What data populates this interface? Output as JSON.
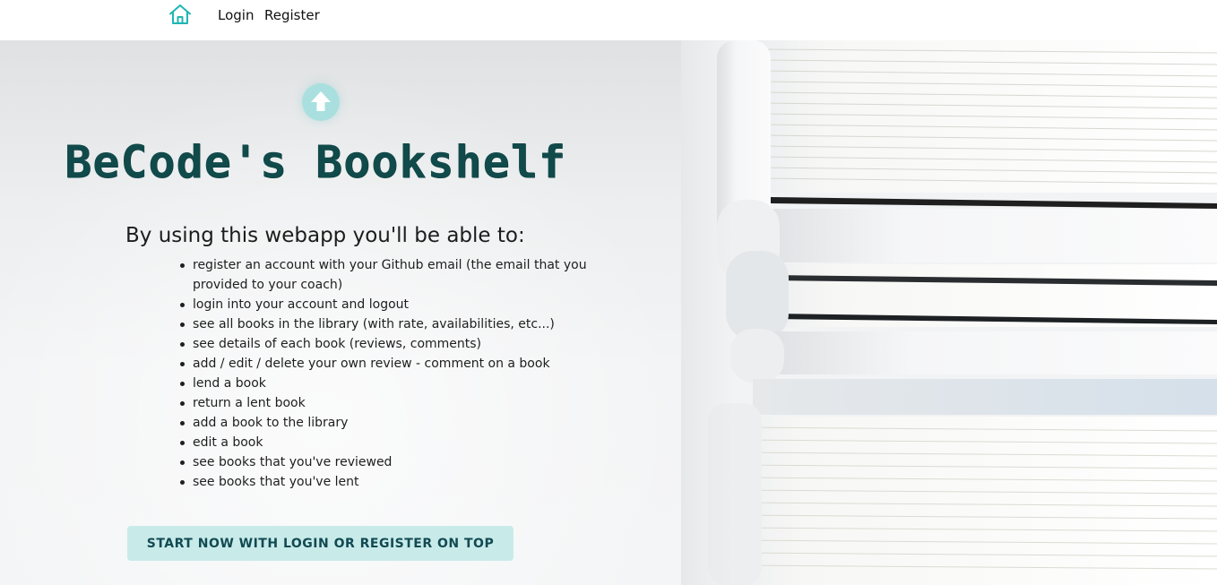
{
  "nav": {
    "login_label": "Login",
    "register_label": "Register",
    "accent_color": "#1fb5b3"
  },
  "hero": {
    "title": "BeCode's Bookshelf",
    "features_heading": "By using this webapp you'll be able to:",
    "features": [
      "register an account with your Github email (the email that you provided to your coach)",
      "login into your account and logout",
      "see all books in the library (with rate, availabilities, etc...)",
      "see details of each book (reviews, comments)",
      "add / edit / delete your own review - comment on a book",
      "lend a book",
      "return a lent book",
      "add a book to the library",
      "edit a book",
      "see books that you've reviewed",
      "see books that you've lent"
    ],
    "cta_label": "START NOW WITH LOGIN OR REGISTER ON TOP",
    "scroll_icon": "arrow-up-icon",
    "title_color": "#114a4a",
    "cta_bg_color": "#c8ebea"
  }
}
